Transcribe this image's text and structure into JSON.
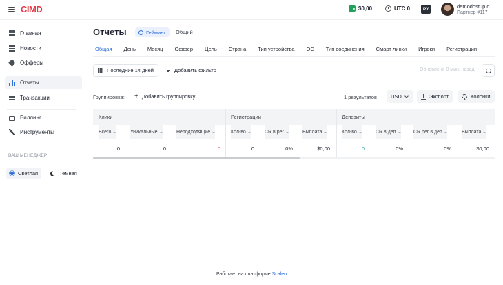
{
  "brand": {
    "logo": "CIMD",
    "accent": "#2f6fd6",
    "logo_color": "#e63946"
  },
  "header": {
    "balance": "$0,00",
    "timezone": "UTC 0",
    "language": "РУ",
    "user_name": "demodostup d.",
    "user_sub": "Партнер #117"
  },
  "sidebar": {
    "items": [
      {
        "label": "Главная",
        "icon": "grid-icon"
      },
      {
        "label": "Новости",
        "icon": "news-icon"
      },
      {
        "label": "Офферы",
        "icon": "tag-icon"
      },
      {
        "label": "Отчеты",
        "icon": "bar-chart-icon",
        "active": true
      },
      {
        "label": "Транзакции",
        "icon": "transactions-icon"
      },
      {
        "label": "Биллинг",
        "icon": "card-icon"
      },
      {
        "label": "Инструменты",
        "icon": "wrench-icon"
      }
    ],
    "manager_label": "ВАШ МЕНЕДЖЕР",
    "theme_light": "Светлая",
    "theme_dark": "Темная"
  },
  "page": {
    "title": "Отчеты",
    "pill_gaming": "Гейминг",
    "pill_general": "Общий"
  },
  "tabs": [
    "Общая",
    "День",
    "Месяц",
    "Оффер",
    "Цель",
    "Страна",
    "Тип устройства",
    "ОС",
    "Тип соединения",
    "Смарт линки",
    "Игроки",
    "Регистрации"
  ],
  "toolbar": {
    "date_range": "Последние 14 дней",
    "add_filter": "Добавить фильтр",
    "updated": "Обновлено 0 мин. назад"
  },
  "grouping": {
    "label": "Группировка:",
    "add_grouping": "Добавить группировку",
    "results": "1  результатов",
    "currency": "USD",
    "export": "Экспорт",
    "columns": "Колонки"
  },
  "table": {
    "groups": [
      "Клики",
      "Регистрации",
      "Депозиты"
    ],
    "columns": [
      "Всего",
      "Уникальные",
      "Неподходящие",
      "Кол-во",
      "CR в рег",
      "Выплата",
      "Кол-во",
      "CR в деп",
      "CR рег в деп",
      "Выплата"
    ],
    "row": [
      "0",
      "0",
      "0",
      "0",
      "0%",
      "$0,00",
      "0",
      "0%",
      "0%",
      "$0,00"
    ]
  },
  "footer": {
    "text": "Работает на платформе ",
    "link": "Scaleo"
  }
}
